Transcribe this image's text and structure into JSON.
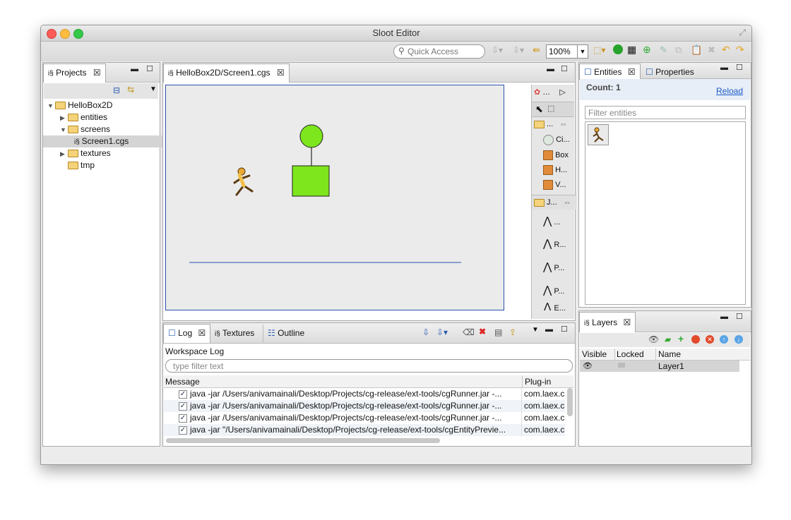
{
  "window": {
    "title": "Sloot Editor"
  },
  "toolbar": {
    "quick_access_placeholder": "Quick Access",
    "zoom": "100%"
  },
  "projects": {
    "tab_label": "Projects",
    "tree": {
      "root": "HelloBox2D",
      "entities": "entities",
      "screens": "screens",
      "screen_file": "Screen1.cgs",
      "textures": "textures",
      "tmp": "tmp"
    }
  },
  "editor": {
    "tab_label": "HelloBox2D/Screen1.cgs",
    "palette": {
      "group1_label": "...",
      "shapes": [
        "Ci...",
        "Box",
        "H...",
        "V..."
      ],
      "group2_label": "J...",
      "joints": [
        "...",
        "R...",
        "P...",
        "P...",
        "E..."
      ]
    }
  },
  "entities_panel": {
    "tab_entities": "Entities",
    "tab_properties": "Properties",
    "count_label": "Count: 1",
    "reload_label": "Reload",
    "filter_placeholder": "Filter entities"
  },
  "layers_panel": {
    "tab_label": "Layers",
    "columns": [
      "Visible",
      "Locked",
      "Name"
    ],
    "rows": [
      {
        "name": "Layer1"
      }
    ]
  },
  "bottom_panel": {
    "tabs": [
      "Log",
      "Textures",
      "Outline"
    ],
    "workspace_label": "Workspace Log",
    "filter_placeholder": "type filter text",
    "columns": [
      "Message",
      "Plug-in"
    ],
    "rows": [
      {
        "message": "java -jar /Users/anivamainali/Desktop/Projects/cg-release/ext-tools/cgRunner.jar -...",
        "plugin": "com.laex.c"
      },
      {
        "message": "java -jar /Users/anivamainali/Desktop/Projects/cg-release/ext-tools/cgRunner.jar -...",
        "plugin": "com.laex.c"
      },
      {
        "message": "java -jar /Users/anivamainali/Desktop/Projects/cg-release/ext-tools/cgRunner.jar -...",
        "plugin": "com.laex.c"
      },
      {
        "message": "java -jar \"/Users/anivamainali/Desktop/Projects/cg-release/ext-tools/cgEntityPrevie...",
        "plugin": "com.laex.c"
      }
    ]
  },
  "colors": {
    "accent": "#7de61c",
    "selection": "#d4d4d4",
    "link": "#1a59c8"
  }
}
